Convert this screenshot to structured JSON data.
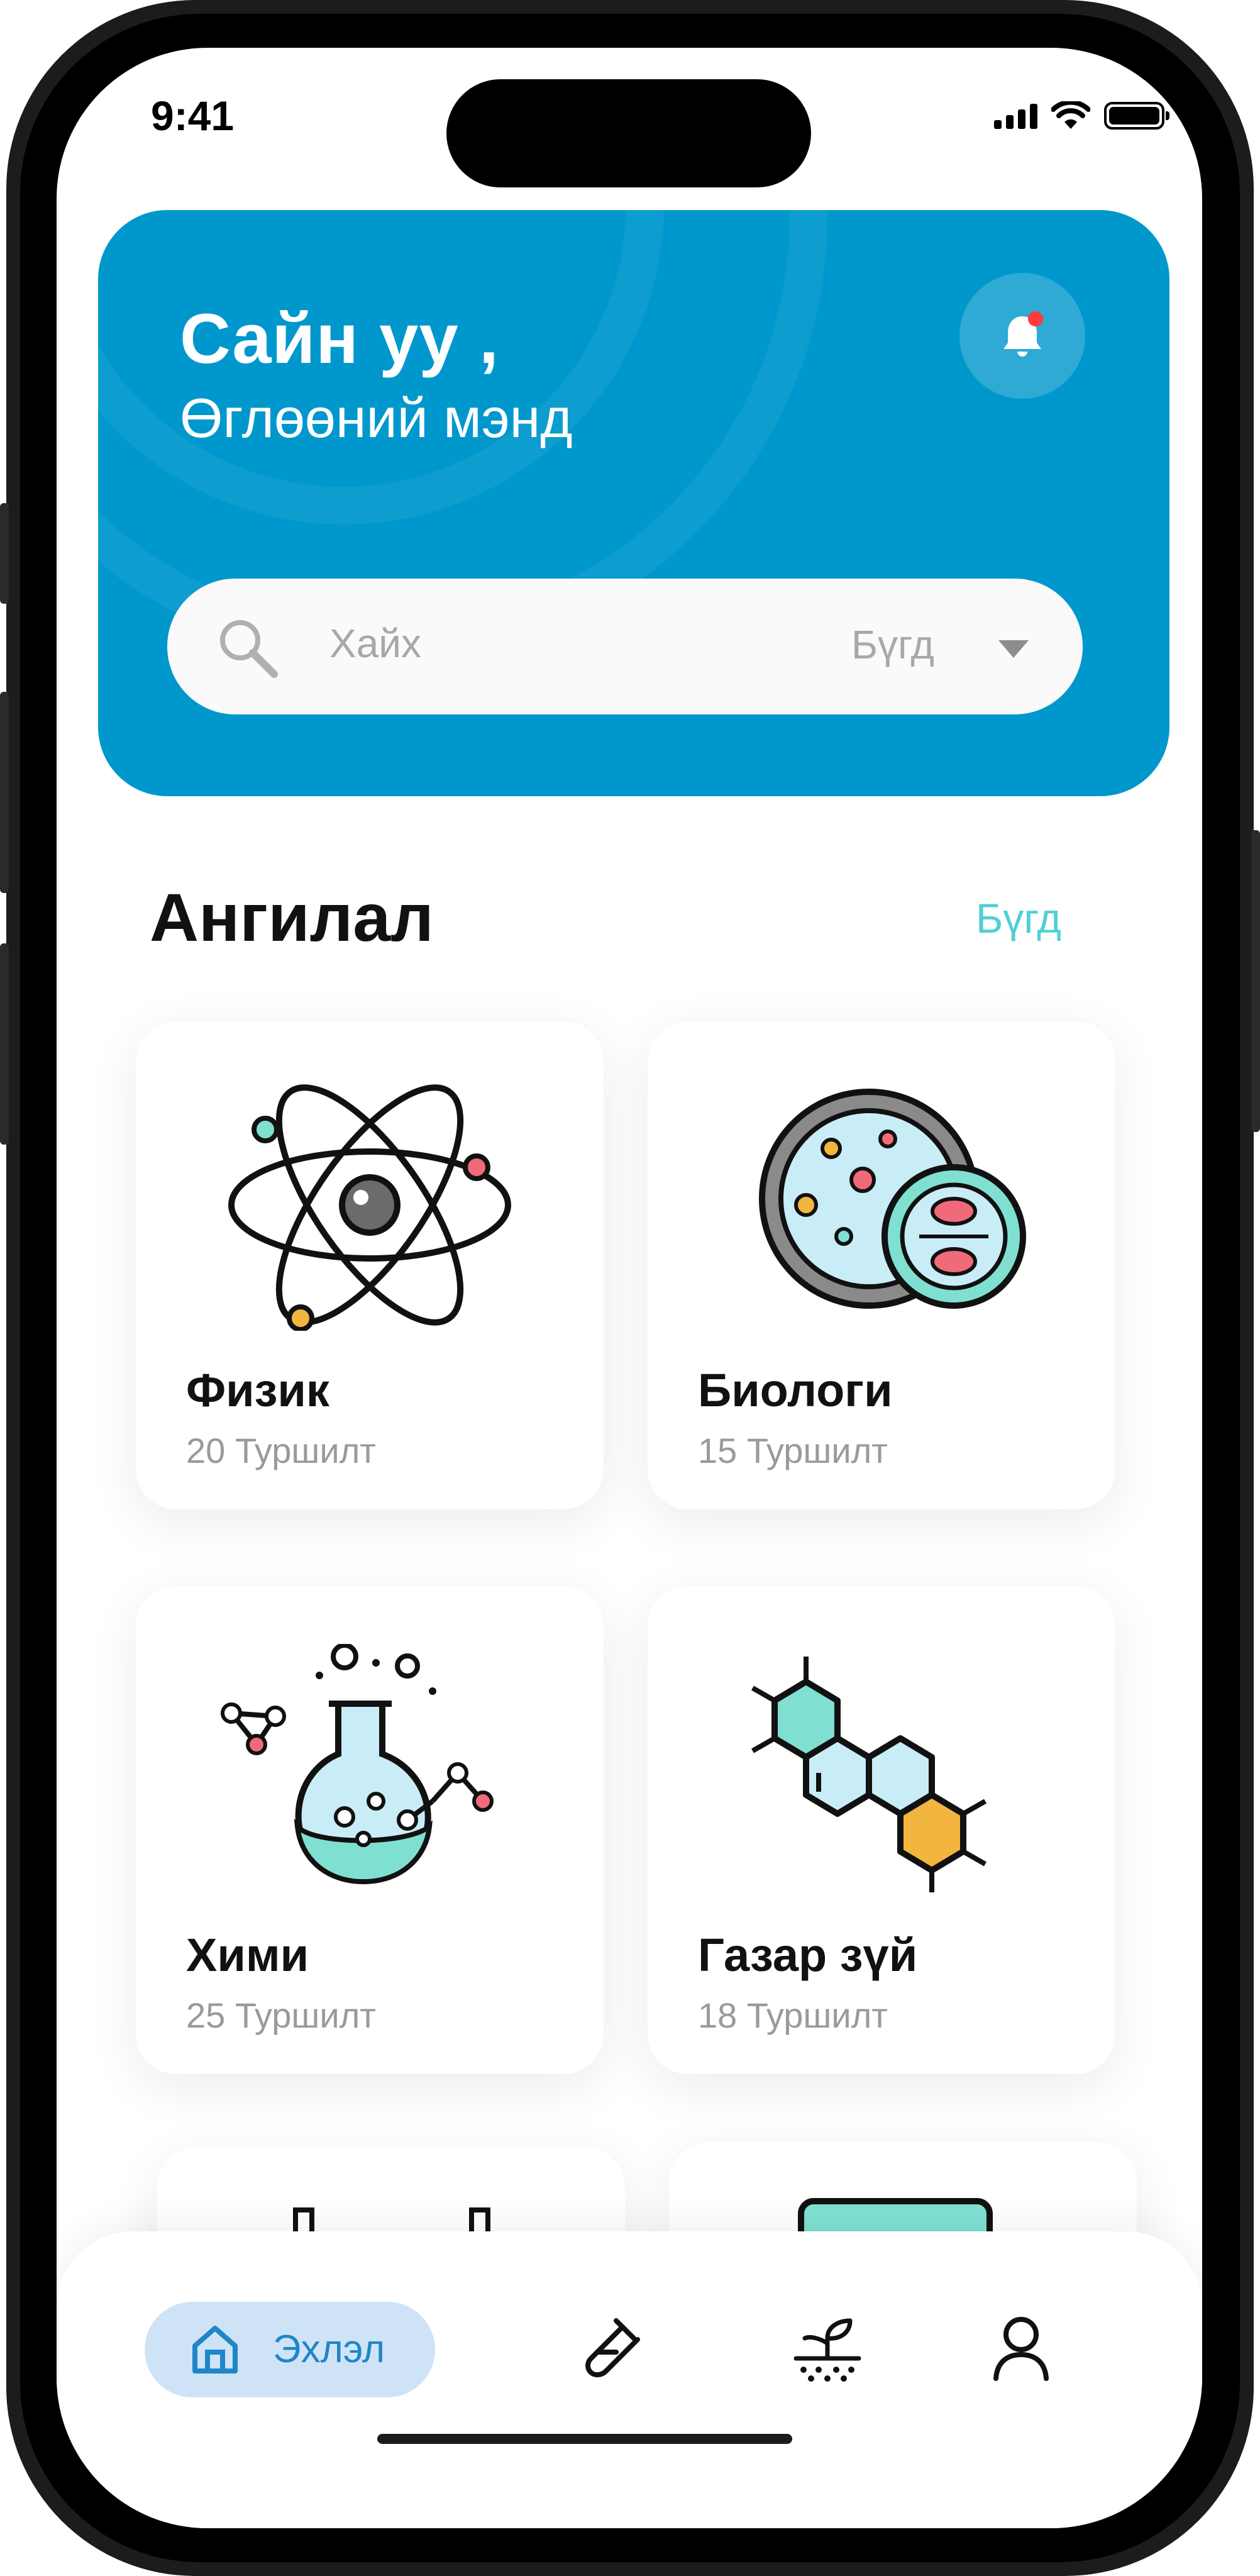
{
  "status_bar": {
    "time": "9:41"
  },
  "header": {
    "greeting": "Сайн уу ,",
    "subgreeting": "Өглөөний мэнд",
    "notification_icon": "bell-icon",
    "colors": {
      "hero_bg": "#0098cc",
      "badge": "#ff3b3b"
    }
  },
  "search": {
    "placeholder": "Хайх",
    "filter_value": "Бүгд"
  },
  "categories": {
    "title": "Ангилал",
    "see_all": "Бүгд",
    "items": [
      {
        "name": "Физик",
        "count": "20 Туршилт",
        "icon": "atom-icon"
      },
      {
        "name": "Биологи",
        "count": "15 Туршилт",
        "icon": "petri-dish-icon"
      },
      {
        "name": "Хими",
        "count": "25 Туршилт",
        "icon": "flask-icon"
      },
      {
        "name": "Газар зүй",
        "count": "18 Туршилт",
        "icon": "molecule-icon"
      }
    ]
  },
  "tab_bar": {
    "home_label": "Эхлэл",
    "items": [
      "home-icon",
      "test-tube-icon",
      "plant-icon",
      "profile-icon"
    ],
    "active_color": "#1f86c7"
  }
}
